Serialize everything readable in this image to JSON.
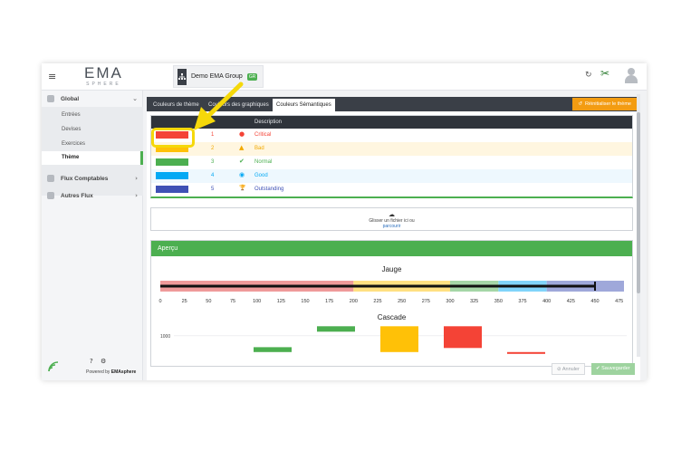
{
  "topbar": {
    "hamburger": "≡",
    "logo_main": "EMA",
    "logo_sub": "SPHERE",
    "org_name": "Demo EMA Group",
    "org_badge": "GR",
    "refresh_glyph": "↻",
    "tools_glyph": "✂",
    "icons": [
      "menu-icon",
      "org-tree-icon",
      "refresh-icon",
      "tools-icon",
      "user-avatar"
    ]
  },
  "sidebar": {
    "groups": [
      {
        "label": "Global",
        "chev": "⌄"
      },
      {
        "label": "Flux Comptables",
        "chev": "›"
      },
      {
        "label": "Autres Flux",
        "chev": "›"
      }
    ],
    "subitems": [
      "Entrées",
      "Devises",
      "Exercices",
      "Thème"
    ],
    "active_subitem": "Thème",
    "footer_help": "?",
    "footer_settings": "⚙",
    "powered_prefix": "Powered by",
    "powered_brand": "EMAsphere"
  },
  "tabs": {
    "items": [
      "Couleurs de thème",
      "Couleurs des graphiques",
      "Couleurs Sémantiques"
    ],
    "active": "Couleurs Sémantiques",
    "reinit_label": "Réinitialiser le thème",
    "reinit_glyph": "↺"
  },
  "table": {
    "header_description": "Description",
    "rows": [
      {
        "num": "1",
        "desc": "Critical",
        "color": "#f44336",
        "glyph": "●",
        "icon": "error-circle-icon"
      },
      {
        "num": "2",
        "desc": "Bad",
        "color": "#ffc107",
        "glyph": "▲",
        "icon": "warning-triangle-icon"
      },
      {
        "num": "3",
        "desc": "Normal",
        "color": "#4caf50",
        "glyph": "✔",
        "icon": "check-icon"
      },
      {
        "num": "4",
        "desc": "Good",
        "color": "#03a9f4",
        "glyph": "◉",
        "icon": "check-circle-icon"
      },
      {
        "num": "5",
        "desc": "Outstanding",
        "color": "#3f51b5",
        "glyph": "🏆",
        "icon": "trophy-icon"
      }
    ]
  },
  "upload": {
    "cloud_glyph": "☁",
    "text": "Glisser un fichier ici ou",
    "link": "parcourir"
  },
  "apercu": {
    "title": "Aperçu",
    "jauge_title": "Jauge",
    "cascade_title": "Cascade"
  },
  "chart_data": [
    {
      "type": "bar",
      "title": "Jauge",
      "xlim": [
        0,
        480
      ],
      "ticks": [
        0,
        25,
        50,
        75,
        100,
        125,
        150,
        175,
        200,
        225,
        250,
        275,
        300,
        325,
        350,
        375,
        400,
        425,
        450,
        475
      ],
      "bands": [
        {
          "from": 0,
          "to": 200,
          "color": "#ef9a9a"
        },
        {
          "from": 200,
          "to": 300,
          "color": "#ffe082"
        },
        {
          "from": 300,
          "to": 350,
          "color": "#a5d6a7"
        },
        {
          "from": 350,
          "to": 400,
          "color": "#81d4fa"
        },
        {
          "from": 400,
          "to": 480,
          "color": "#9fa8da"
        }
      ],
      "value": 450,
      "value_color": "#111111"
    },
    {
      "type": "bar",
      "title": "Cascade",
      "y_ticks": [
        1000
      ],
      "bars": [
        {
          "low": 400,
          "high": 580,
          "color": "#4caf50"
        },
        {
          "low": 1150,
          "high": 1350,
          "color": "#4caf50"
        },
        {
          "low": 400,
          "high": 1350,
          "color": "#ffc107"
        },
        {
          "low": 550,
          "high": 1350,
          "color": "#f44336"
        },
        {
          "low": 360,
          "high": 400,
          "color": "#f44336"
        }
      ]
    }
  ],
  "actions": {
    "cancel_label": "Annuler",
    "cancel_glyph": "⊘",
    "save_label": "Sauvegarder",
    "save_glyph": "✔"
  }
}
